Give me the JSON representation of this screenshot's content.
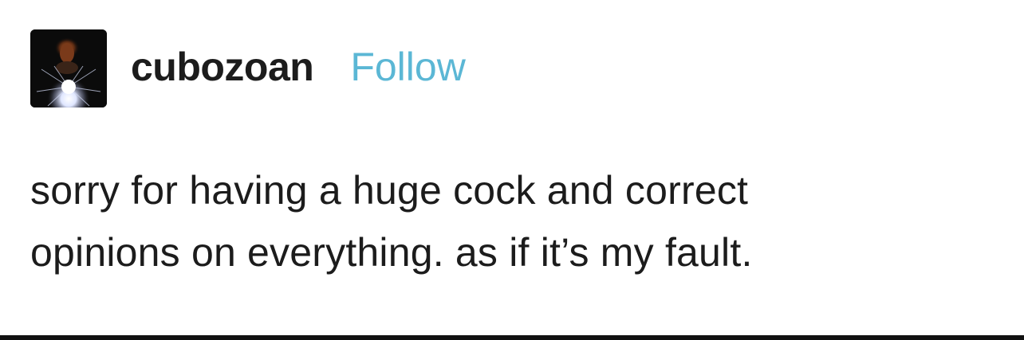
{
  "post": {
    "author": {
      "username": "cubozoan",
      "avatar_icon": "avatar-photo"
    },
    "follow_label": "Follow",
    "follow_color": "#5bb7d5",
    "body_lines": [
      "sorry for having a huge cock and correct",
      "opinions on everything. as if it’s my fault."
    ]
  }
}
